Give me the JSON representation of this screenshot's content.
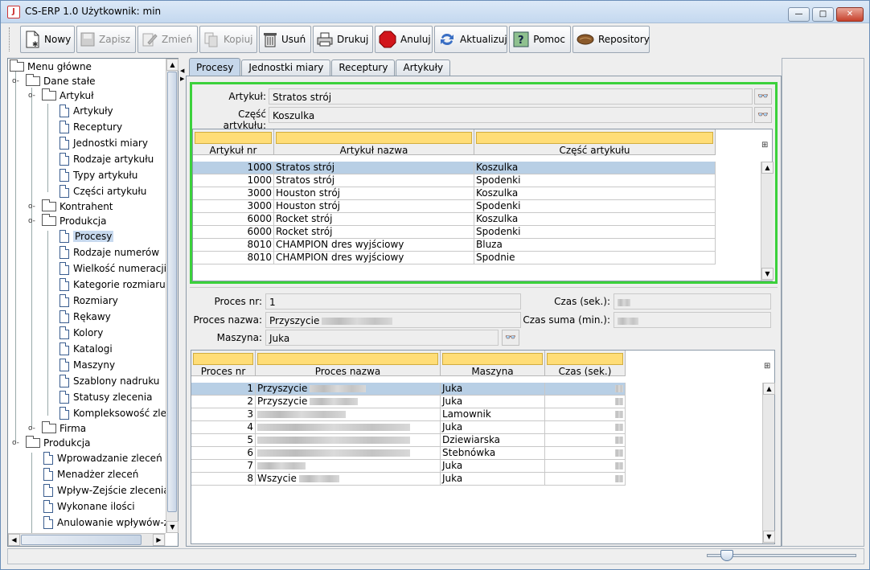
{
  "window": {
    "title": "CS-ERP 1.0  Użytkownik: min",
    "minimize": "—",
    "maximize": "□",
    "close": "✕"
  },
  "toolbar": {
    "new": "Nowy",
    "save": "Zapisz",
    "edit": "Zmień",
    "copy": "Kopiuj",
    "delete": "Usuń",
    "print": "Drukuj",
    "cancel": "Anuluj",
    "refresh": "Aktualizuj",
    "help": "Pomoc",
    "repository": "Repository"
  },
  "tree": {
    "root": "Menu główne",
    "dane_stale": "Dane stałe",
    "artykul": "Artykuł",
    "artykuly": "Artykuły",
    "receptury": "Receptury",
    "jednostki_miary": "Jednostki miary",
    "rodzaje_artykulu": "Rodzaje artykułu",
    "typy_artykulu": "Typy artykułu",
    "czesci_artykulu": "Części artykułu",
    "kontrahent": "Kontrahent",
    "produkcja_folder": "Produkcja",
    "procesy": "Procesy",
    "rodzaje_numerow": "Rodzaje numerów",
    "wielkosc_numeracji": "Wielkość numeracji",
    "kategorie_rozmiaru": "Kategorie rozmiaru",
    "rozmiary": "Rozmiary",
    "rekawy": "Rękawy",
    "kolory": "Kolory",
    "katalogi": "Katalogi",
    "maszyny": "Maszyny",
    "szablony_nadruku": "Szablony nadruku",
    "statusy_zlecenia": "Statusy zlecenia",
    "kompleksowosc": "Kompleksowość zlec",
    "firma": "Firma",
    "produkcja_main": "Produkcja",
    "wprowadzanie": "Wprowadzanie zleceń",
    "menadzer": "Menadżer zleceń",
    "wplyw": "Wpływ-Zejście zlecenia",
    "wykonane": "Wykonane ilości",
    "anulowanie": "Anulowanie wpływów-zej"
  },
  "tabs": [
    "Procesy",
    "Jednostki miary",
    "Receptury",
    "Artykuły"
  ],
  "article_filter": {
    "artykul_label": "Artykuł:",
    "artykul_value": "Stratos strój",
    "czesc_label": "Część artykułu:",
    "czesc_value": "Koszulka"
  },
  "article_grid": {
    "headers": [
      "Artykuł nr",
      "Artykuł nazwa",
      "Część artykułu"
    ],
    "rows": [
      [
        "1000",
        "Stratos strój",
        "Koszulka"
      ],
      [
        "1000",
        "Stratos strój",
        "Spodenki"
      ],
      [
        "3000",
        "Houston strój",
        "Koszulka"
      ],
      [
        "3000",
        "Houston strój",
        "Spodenki"
      ],
      [
        "6000",
        "Rocket strój",
        "Koszulka"
      ],
      [
        "6000",
        "Rocket strój",
        "Spodenki"
      ],
      [
        "8010",
        "CHAMPION dres wyjściowy",
        "Bluza"
      ],
      [
        "8010",
        "CHAMPION dres wyjściowy",
        "Spodnie"
      ]
    ],
    "selected_row": 0
  },
  "process_form": {
    "nr_label": "Proces nr:",
    "nr_value": "1",
    "nazwa_label": "Proces nazwa:",
    "nazwa_value": "Przyszycie",
    "maszyna_label": "Maszyna:",
    "maszyna_value": "Juka",
    "czas_label": "Czas (sek.):",
    "czas_suma_label": "Czas suma (min.):"
  },
  "process_grid": {
    "headers": [
      "Proces nr",
      "Proces nazwa",
      "Maszyna",
      "Czas (sek.)"
    ],
    "rows": [
      [
        "1",
        "Przyszycie",
        "Juka"
      ],
      [
        "2",
        "Przyszycie",
        "Juka"
      ],
      [
        "3",
        "",
        "Lamownik"
      ],
      [
        "4",
        "",
        "Juka"
      ],
      [
        "5",
        "",
        "Dziewiarska"
      ],
      [
        "6",
        "",
        "Stebnówka"
      ],
      [
        "7",
        "",
        "Juka"
      ],
      [
        "8",
        "Wszycie",
        "Juka"
      ]
    ],
    "selected_row": 0
  },
  "colors": {
    "accent_green": "#3bd13b",
    "header_yellow": "#ffdd77",
    "selection": "#b8cfe5"
  }
}
